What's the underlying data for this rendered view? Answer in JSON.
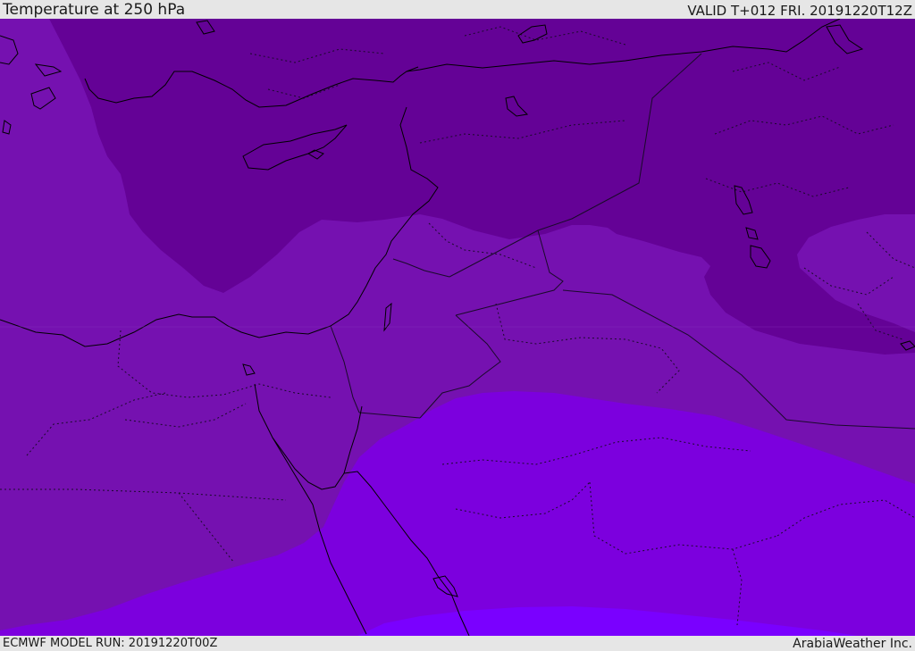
{
  "header": {
    "title": "Temperature at 250 hPa",
    "valid": "VALID T+012 FRI. 20191220T12Z"
  },
  "footer": {
    "model_run": "ECMWF MODEL RUN: 20191220T00Z",
    "credit": "ArabiaWeather Inc."
  },
  "colors": {
    "band_coldest": "#640296",
    "band_cold": "#7511b0",
    "band_mid": "#7c00de",
    "band_warm": "#7a00ff",
    "coastline": "#000000",
    "borders": "#1a0a2a"
  },
  "map_layers": [
    "filled-temperature-bands",
    "coastlines",
    "country-borders",
    "province-borders"
  ]
}
